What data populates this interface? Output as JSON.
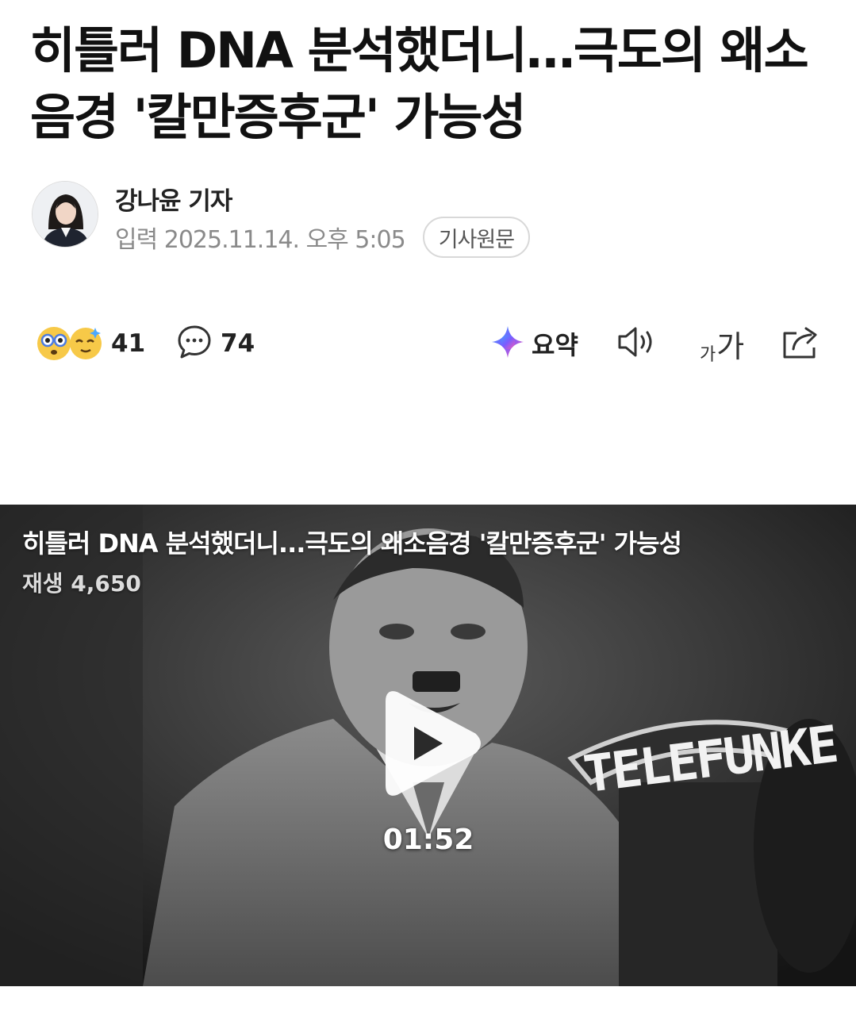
{
  "article": {
    "title": "히틀러 DNA 분석했더니…극도의 왜소음경 '칼만증후군' 가능성",
    "author": "강나윤 기자",
    "date": "입력 2025.11.14. 오후 5:05",
    "original_button": "기사원문"
  },
  "toolbar": {
    "reaction_count": "41",
    "comment_count": "74",
    "summary_label": "요약",
    "font_size_label_small": "가",
    "font_size_label_large": "가"
  },
  "video": {
    "title": "히틀러 DNA 분석했더니...극도의 왜소음경 '칼만증후군' 가능성",
    "plays": "재생 4,650",
    "duration": "01:52",
    "sign_text": "TELEFUNKE"
  },
  "colors": {
    "text_primary": "#111111",
    "text_meta": "#8a8a8a",
    "summary_icon": "#5b6cff",
    "video_bg": "#1b1b1b"
  },
  "icons": [
    "reaction-emoji-icon",
    "comment-icon",
    "ai-summary-icon",
    "speaker-icon",
    "font-size-icon",
    "share-icon",
    "play-icon"
  ]
}
